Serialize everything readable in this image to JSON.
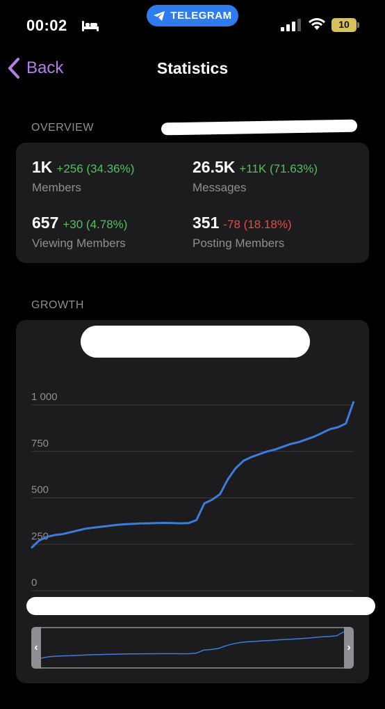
{
  "status_bar": {
    "time": "00:02",
    "pill_label": "TELEGRAM",
    "battery": "10"
  },
  "nav": {
    "back_label": "Back",
    "title": "Statistics"
  },
  "overview": {
    "header": "OVERVIEW",
    "stats": [
      {
        "value": "1K",
        "change": "+256 (34.36%)",
        "trend": "up",
        "label": "Members"
      },
      {
        "value": "26.5K",
        "change": "+11K (71.63%)",
        "trend": "up",
        "label": "Messages"
      },
      {
        "value": "657",
        "change": "+30 (4.78%)",
        "trend": "up",
        "label": "Viewing Members"
      },
      {
        "value": "351",
        "change": "-78 (18.18%)",
        "trend": "down",
        "label": "Posting Members"
      }
    ]
  },
  "growth": {
    "header": "GROWTH",
    "chart_data": {
      "type": "line",
      "ylim": [
        0,
        1000
      ],
      "yticks": [
        "1 000",
        "750",
        "500",
        "250",
        "0"
      ],
      "grid": true,
      "color": "#3b7ddd",
      "series": [
        {
          "values": [
            230,
            270,
            290,
            300,
            305,
            315,
            325,
            335,
            340,
            345,
            350,
            355,
            358,
            360,
            362,
            363,
            364,
            365,
            364,
            363,
            364,
            380,
            470,
            490,
            520,
            600,
            660,
            700,
            720,
            735,
            750,
            760,
            775,
            790,
            800,
            815,
            830,
            850,
            870,
            880,
            900,
            1020
          ]
        }
      ]
    }
  },
  "colors": {
    "positive": "#4fc35a",
    "negative": "#e54b45",
    "accent": "#b57ee8",
    "line": "#3b7ddd"
  }
}
